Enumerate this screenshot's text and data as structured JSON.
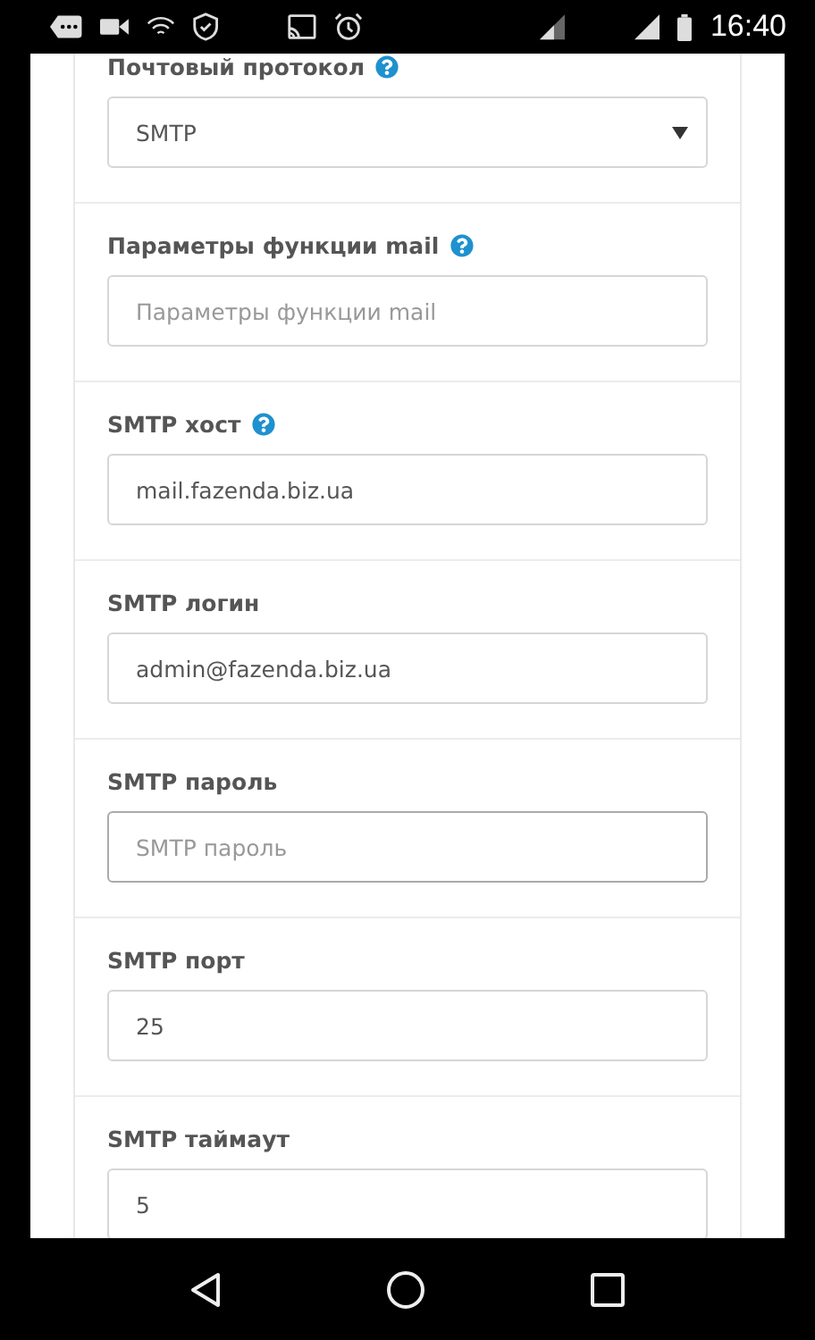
{
  "status_bar": {
    "time": "16:40"
  },
  "fields": [
    {
      "kind": "select",
      "label": "Почтовый протокол",
      "help": true,
      "value": "SMTP",
      "focused": false
    },
    {
      "kind": "input",
      "label": "Параметры функции mail",
      "help": true,
      "placeholder": "Параметры функции mail",
      "focused": false
    },
    {
      "kind": "input",
      "label": "SMTP хост",
      "help": true,
      "value": "mail.fazenda.biz.ua",
      "focused": false
    },
    {
      "kind": "input",
      "label": "SMTP логин",
      "help": false,
      "value": "admin@fazenda.biz.ua",
      "focused": false
    },
    {
      "kind": "input",
      "label": "SMTP пароль",
      "help": false,
      "placeholder": "SMTP пароль",
      "focused": true
    },
    {
      "kind": "input",
      "label": "SMTP порт",
      "help": false,
      "value": "25",
      "focused": false
    },
    {
      "kind": "input",
      "label": "SMTP таймаут",
      "help": false,
      "value": "5",
      "focused": false
    }
  ]
}
